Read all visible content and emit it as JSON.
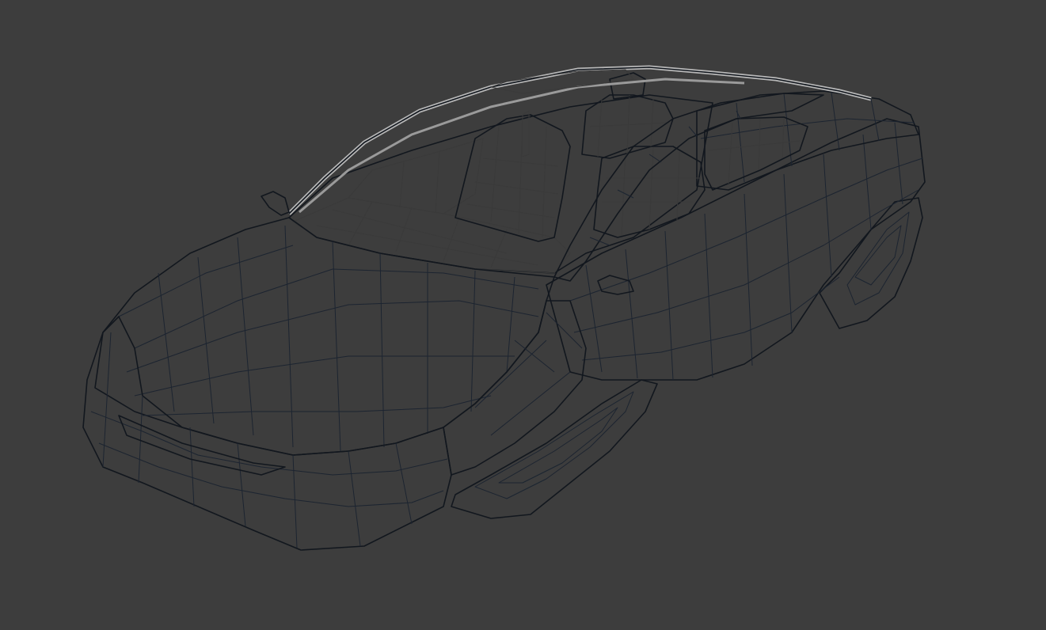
{
  "viewport": {
    "background_color": "#3d3d3d",
    "mesh_body_color": "#4a6582",
    "mesh_shadow_color": "#2e4259",
    "mesh_interior_color": "#c8c8c8",
    "wire_color": "#1c2430"
  }
}
